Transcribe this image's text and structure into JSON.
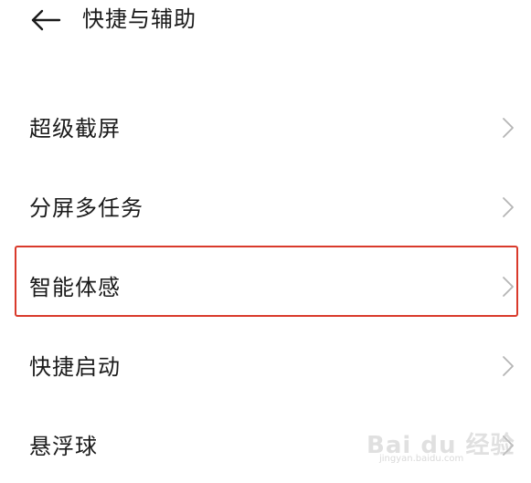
{
  "header": {
    "back_icon": "arrow-left-icon",
    "title": "快捷与辅助"
  },
  "list": {
    "items": [
      {
        "label": "超级截屏",
        "icon": "chevron-right-icon"
      },
      {
        "label": "分屏多任务",
        "icon": "chevron-right-icon"
      },
      {
        "label": "智能体感",
        "icon": "chevron-right-icon",
        "highlighted": true
      },
      {
        "label": "快捷启动",
        "icon": "chevron-right-icon"
      },
      {
        "label": "悬浮球",
        "icon": "chevron-right-icon"
      }
    ]
  },
  "watermark": {
    "brand": "Bai du 经验",
    "url": "jingyan.baidu.com"
  },
  "colors": {
    "highlight_border": "#d93a2b",
    "text": "#1a1a1a",
    "chevron": "#b5b5b5"
  }
}
